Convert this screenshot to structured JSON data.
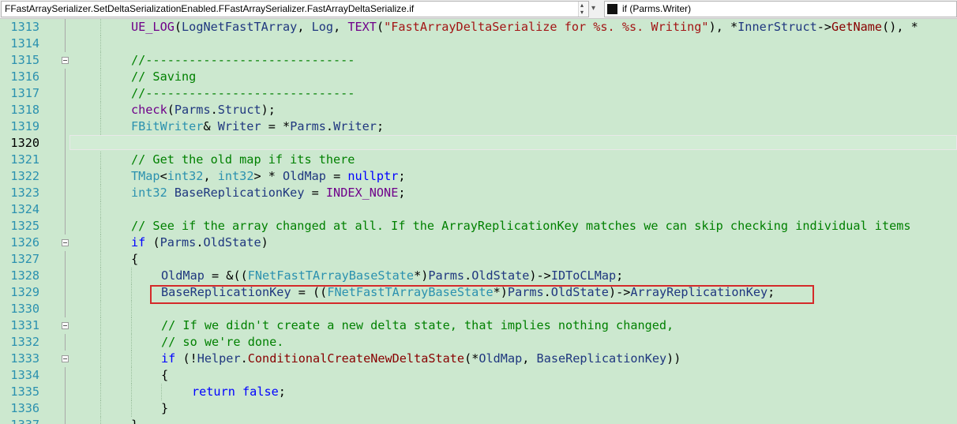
{
  "navbar": {
    "scope_value": "FFastArraySerializer.SetDeltaSerializationEnabled.FFastArraySerializer.FastArrayDeltaSerialize.if",
    "member_value": "if (Parms.Writer)"
  },
  "editor": {
    "current_line": "1320",
    "lines": [
      {
        "n": "1313"
      },
      {
        "n": "1314"
      },
      {
        "n": "1315"
      },
      {
        "n": "1316"
      },
      {
        "n": "1317"
      },
      {
        "n": "1318"
      },
      {
        "n": "1319"
      },
      {
        "n": "1320"
      },
      {
        "n": "1321"
      },
      {
        "n": "1322"
      },
      {
        "n": "1323"
      },
      {
        "n": "1324"
      },
      {
        "n": "1325"
      },
      {
        "n": "1326"
      },
      {
        "n": "1327"
      },
      {
        "n": "1328"
      },
      {
        "n": "1329"
      },
      {
        "n": "1330"
      },
      {
        "n": "1331"
      },
      {
        "n": "1332"
      },
      {
        "n": "1333"
      },
      {
        "n": "1334"
      },
      {
        "n": "1335"
      },
      {
        "n": "1336"
      },
      {
        "n": "1337"
      }
    ],
    "t": {
      "l1313_a": "UE_LOG",
      "l1313_b": "(",
      "l1313_c": "LogNetFastTArray",
      "l1313_d": ", ",
      "l1313_e": "Log",
      "l1313_f": ", ",
      "l1313_g": "TEXT",
      "l1313_h": "(",
      "l1313_i": "\"FastArrayDeltaSerialize for %s. %s. Writing\"",
      "l1313_j": "), *",
      "l1313_k": "InnerStruct",
      "l1313_l": "->",
      "l1313_m": "GetName",
      "l1313_n": "(), *",
      "l1315": "//-----------------------------",
      "l1316": "// Saving",
      "l1317": "//-----------------------------",
      "l1318_a": "check",
      "l1318_b": "(",
      "l1318_c": "Parms",
      "l1318_d": ".",
      "l1318_e": "Struct",
      "l1318_f": ");",
      "l1319_a": "FBitWriter",
      "l1319_b": "& ",
      "l1319_c": "Writer",
      "l1319_d": " = *",
      "l1319_e": "Parms",
      "l1319_f": ".",
      "l1319_g": "Writer",
      "l1319_h": ";",
      "l1321": "// Get the old map if its there",
      "l1322_a": "TMap",
      "l1322_b": "<",
      "l1322_c": "int32",
      "l1322_d": ", ",
      "l1322_e": "int32",
      "l1322_f": "> * ",
      "l1322_g": "OldMap",
      "l1322_h": " = ",
      "l1322_i": "nullptr",
      "l1322_j": ";",
      "l1323_a": "int32",
      "l1323_b": " ",
      "l1323_c": "BaseReplicationKey",
      "l1323_d": " = ",
      "l1323_e": "INDEX_NONE",
      "l1323_f": ";",
      "l1325": "// See if the array changed at all. If the ArrayReplicationKey matches we can skip checking individual items",
      "l1326_a": "if",
      "l1326_b": " (",
      "l1326_c": "Parms",
      "l1326_d": ".",
      "l1326_e": "OldState",
      "l1326_f": ")",
      "l1327": "{",
      "l1328_a": "OldMap",
      "l1328_b": " = &((",
      "l1328_c": "FNetFastTArrayBaseState",
      "l1328_d": "*)",
      "l1328_e": "Parms",
      "l1328_f": ".",
      "l1328_g": "OldState",
      "l1328_h": ")->",
      "l1328_i": "IDToCLMap",
      "l1328_j": ";",
      "l1329_a": "BaseReplicationKey",
      "l1329_b": " = ((",
      "l1329_c": "FNetFastTArrayBaseState",
      "l1329_d": "*)",
      "l1329_e": "Parms",
      "l1329_f": ".",
      "l1329_g": "OldState",
      "l1329_h": ")->",
      "l1329_i": "ArrayReplicationKey",
      "l1329_j": ";",
      "l1331": "// If we didn't create a new delta state, that implies nothing changed,",
      "l1332": "// so we're done.",
      "l1333_a": "if",
      "l1333_b": " (!",
      "l1333_c": "Helper",
      "l1333_d": ".",
      "l1333_e": "ConditionalCreateNewDeltaState",
      "l1333_f": "(*",
      "l1333_g": "OldMap",
      "l1333_h": ", ",
      "l1333_i": "BaseReplicationKey",
      "l1333_j": "))",
      "l1334": "{",
      "l1335_a": "return",
      "l1335_b": " ",
      "l1335_c": "false",
      "l1335_d": ";",
      "l1336": "}",
      "l1337": "}"
    }
  }
}
